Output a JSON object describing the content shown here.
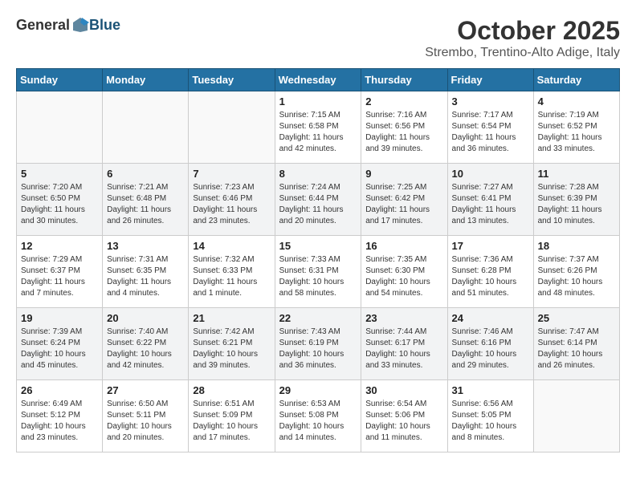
{
  "header": {
    "logo_general": "General",
    "logo_blue": "Blue",
    "month_title": "October 2025",
    "location": "Strembo, Trentino-Alto Adige, Italy"
  },
  "weekdays": [
    "Sunday",
    "Monday",
    "Tuesday",
    "Wednesday",
    "Thursday",
    "Friday",
    "Saturday"
  ],
  "weeks": [
    {
      "shaded": false,
      "days": [
        {
          "number": "",
          "info": ""
        },
        {
          "number": "",
          "info": ""
        },
        {
          "number": "",
          "info": ""
        },
        {
          "number": "1",
          "info": "Sunrise: 7:15 AM\nSunset: 6:58 PM\nDaylight: 11 hours and 42 minutes."
        },
        {
          "number": "2",
          "info": "Sunrise: 7:16 AM\nSunset: 6:56 PM\nDaylight: 11 hours and 39 minutes."
        },
        {
          "number": "3",
          "info": "Sunrise: 7:17 AM\nSunset: 6:54 PM\nDaylight: 11 hours and 36 minutes."
        },
        {
          "number": "4",
          "info": "Sunrise: 7:19 AM\nSunset: 6:52 PM\nDaylight: 11 hours and 33 minutes."
        }
      ]
    },
    {
      "shaded": true,
      "days": [
        {
          "number": "5",
          "info": "Sunrise: 7:20 AM\nSunset: 6:50 PM\nDaylight: 11 hours and 30 minutes."
        },
        {
          "number": "6",
          "info": "Sunrise: 7:21 AM\nSunset: 6:48 PM\nDaylight: 11 hours and 26 minutes."
        },
        {
          "number": "7",
          "info": "Sunrise: 7:23 AM\nSunset: 6:46 PM\nDaylight: 11 hours and 23 minutes."
        },
        {
          "number": "8",
          "info": "Sunrise: 7:24 AM\nSunset: 6:44 PM\nDaylight: 11 hours and 20 minutes."
        },
        {
          "number": "9",
          "info": "Sunrise: 7:25 AM\nSunset: 6:42 PM\nDaylight: 11 hours and 17 minutes."
        },
        {
          "number": "10",
          "info": "Sunrise: 7:27 AM\nSunset: 6:41 PM\nDaylight: 11 hours and 13 minutes."
        },
        {
          "number": "11",
          "info": "Sunrise: 7:28 AM\nSunset: 6:39 PM\nDaylight: 11 hours and 10 minutes."
        }
      ]
    },
    {
      "shaded": false,
      "days": [
        {
          "number": "12",
          "info": "Sunrise: 7:29 AM\nSunset: 6:37 PM\nDaylight: 11 hours and 7 minutes."
        },
        {
          "number": "13",
          "info": "Sunrise: 7:31 AM\nSunset: 6:35 PM\nDaylight: 11 hours and 4 minutes."
        },
        {
          "number": "14",
          "info": "Sunrise: 7:32 AM\nSunset: 6:33 PM\nDaylight: 11 hours and 1 minute."
        },
        {
          "number": "15",
          "info": "Sunrise: 7:33 AM\nSunset: 6:31 PM\nDaylight: 10 hours and 58 minutes."
        },
        {
          "number": "16",
          "info": "Sunrise: 7:35 AM\nSunset: 6:30 PM\nDaylight: 10 hours and 54 minutes."
        },
        {
          "number": "17",
          "info": "Sunrise: 7:36 AM\nSunset: 6:28 PM\nDaylight: 10 hours and 51 minutes."
        },
        {
          "number": "18",
          "info": "Sunrise: 7:37 AM\nSunset: 6:26 PM\nDaylight: 10 hours and 48 minutes."
        }
      ]
    },
    {
      "shaded": true,
      "days": [
        {
          "number": "19",
          "info": "Sunrise: 7:39 AM\nSunset: 6:24 PM\nDaylight: 10 hours and 45 minutes."
        },
        {
          "number": "20",
          "info": "Sunrise: 7:40 AM\nSunset: 6:22 PM\nDaylight: 10 hours and 42 minutes."
        },
        {
          "number": "21",
          "info": "Sunrise: 7:42 AM\nSunset: 6:21 PM\nDaylight: 10 hours and 39 minutes."
        },
        {
          "number": "22",
          "info": "Sunrise: 7:43 AM\nSunset: 6:19 PM\nDaylight: 10 hours and 36 minutes."
        },
        {
          "number": "23",
          "info": "Sunrise: 7:44 AM\nSunset: 6:17 PM\nDaylight: 10 hours and 33 minutes."
        },
        {
          "number": "24",
          "info": "Sunrise: 7:46 AM\nSunset: 6:16 PM\nDaylight: 10 hours and 29 minutes."
        },
        {
          "number": "25",
          "info": "Sunrise: 7:47 AM\nSunset: 6:14 PM\nDaylight: 10 hours and 26 minutes."
        }
      ]
    },
    {
      "shaded": false,
      "days": [
        {
          "number": "26",
          "info": "Sunrise: 6:49 AM\nSunset: 5:12 PM\nDaylight: 10 hours and 23 minutes."
        },
        {
          "number": "27",
          "info": "Sunrise: 6:50 AM\nSunset: 5:11 PM\nDaylight: 10 hours and 20 minutes."
        },
        {
          "number": "28",
          "info": "Sunrise: 6:51 AM\nSunset: 5:09 PM\nDaylight: 10 hours and 17 minutes."
        },
        {
          "number": "29",
          "info": "Sunrise: 6:53 AM\nSunset: 5:08 PM\nDaylight: 10 hours and 14 minutes."
        },
        {
          "number": "30",
          "info": "Sunrise: 6:54 AM\nSunset: 5:06 PM\nDaylight: 10 hours and 11 minutes."
        },
        {
          "number": "31",
          "info": "Sunrise: 6:56 AM\nSunset: 5:05 PM\nDaylight: 10 hours and 8 minutes."
        },
        {
          "number": "",
          "info": ""
        }
      ]
    }
  ]
}
